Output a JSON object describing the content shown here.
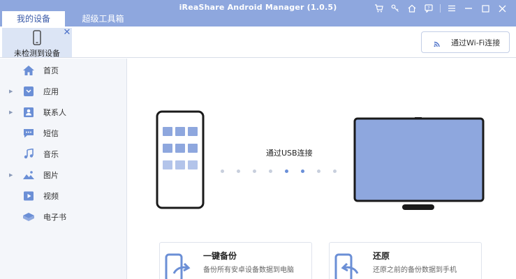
{
  "app": {
    "title": "iReaShare Android Manager (1.0.5)",
    "tabs": [
      {
        "label": "我的设备",
        "active": true
      },
      {
        "label": "超级工具箱",
        "active": false
      }
    ],
    "window_controls": [
      "cart-icon",
      "key-icon",
      "home-icon",
      "feedback-icon",
      "menu-icon",
      "minimize-icon",
      "maximize-icon",
      "close-icon"
    ]
  },
  "device": {
    "status_label": "未检测到设备",
    "wifi_button_label": "通过Wi-Fi连接"
  },
  "sidebar": {
    "items": [
      {
        "label": "首页",
        "icon": "home-icon",
        "expandable": false
      },
      {
        "label": "应用",
        "icon": "apps-icon",
        "expandable": true
      },
      {
        "label": "联系人",
        "icon": "contacts-icon",
        "expandable": true
      },
      {
        "label": "短信",
        "icon": "message-icon",
        "expandable": false
      },
      {
        "label": "音乐",
        "icon": "music-icon",
        "expandable": false
      },
      {
        "label": "图片",
        "icon": "photo-icon",
        "expandable": true
      },
      {
        "label": "视频",
        "icon": "video-icon",
        "expandable": false
      },
      {
        "label": "电子书",
        "icon": "ebook-icon",
        "expandable": false
      }
    ]
  },
  "main": {
    "usb_label": "通过USB连接",
    "cards": [
      {
        "title": "一键备份",
        "desc": "备份所有安卓设备数据到电脑",
        "icon": "backup-icon"
      },
      {
        "title": "还原",
        "desc": "还原之前的备份数据到手机",
        "icon": "restore-icon"
      }
    ]
  },
  "colors": {
    "accent": "#8ea7de",
    "tab_active_text": "#3a5aa8",
    "sidebar_bg": "#f4f6fa",
    "screen_fill": "#8ea7de",
    "icon_blue": "#6b8fd6"
  }
}
